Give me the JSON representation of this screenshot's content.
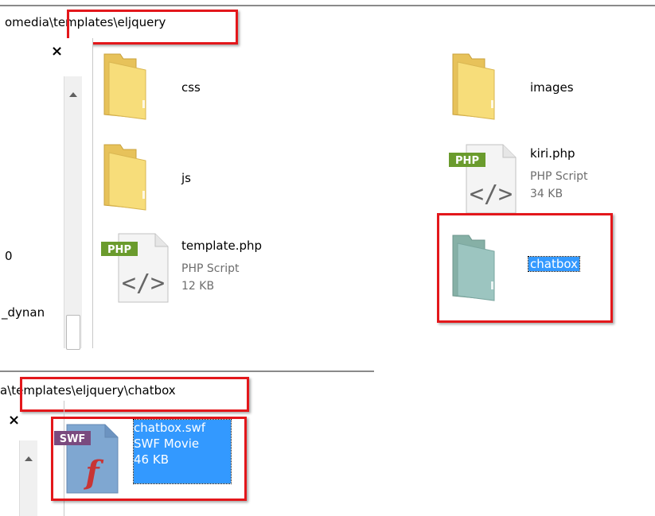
{
  "top_window": {
    "address_path": "omedia\\templates\\eljquery",
    "close_symbol": "×",
    "sidebar_items": [
      "0",
      "_dynan"
    ],
    "items": [
      {
        "name": "css",
        "type": "folder"
      },
      {
        "name": "images",
        "type": "folder"
      },
      {
        "name": "js",
        "type": "folder"
      },
      {
        "name": "kiri.php",
        "type_label": "PHP Script",
        "size": "34 KB",
        "badge": "PHP"
      },
      {
        "name": "template.php",
        "type_label": "PHP Script",
        "size": "12 KB",
        "badge": "PHP"
      },
      {
        "name": "chatbox",
        "type": "folder",
        "selected": true
      }
    ]
  },
  "bottom_window": {
    "address_path": "a\\templates\\eljquery\\chatbox",
    "close_symbol": "×",
    "items": [
      {
        "name": "chatbox.swf",
        "type_label": "SWF Movie",
        "size": "46 KB",
        "badge": "SWF",
        "selected": true
      }
    ]
  },
  "colors": {
    "highlight_red": "#e3171b",
    "selection_blue": "#3399ff",
    "folder_yellow": "#f5d66b",
    "php_green": "#6a9b2d",
    "swf_purple": "#7a4a7e"
  },
  "icons": [
    "folder-icon",
    "php-file-icon",
    "swf-file-icon",
    "close-icon",
    "scroll-up-icon"
  ]
}
